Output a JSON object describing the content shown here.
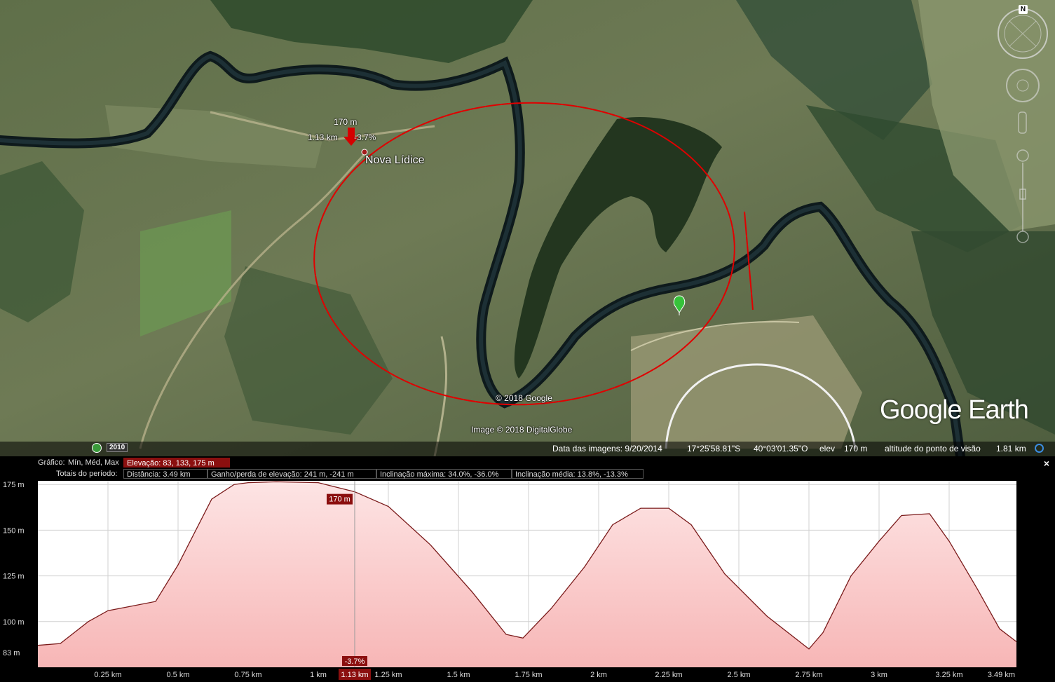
{
  "map": {
    "place_label": "Nova Lídice",
    "pointer_elevation": "170 m",
    "pointer_distance": "1.13 km",
    "pointer_slope": "-3.7%",
    "copyright_google": "© 2018 Google",
    "copyright_imagery": "Image © 2018 DigitalGlobe",
    "logo": "Google Earth",
    "historical_year": "2010",
    "compass_letter": "N"
  },
  "status": {
    "image_date_label": "Data das imagens: 9/20/2014",
    "latitude": "17°25'58.81\"S",
    "longitude": "40°03'01.35\"O",
    "elev_label": "elev",
    "elev_value": "170 m",
    "eye_alt_label": "altitude do ponto de visão",
    "eye_alt_value": "1.81 km"
  },
  "profile": {
    "graph_label": "Gráfico:",
    "graph_options": "Mín, Méd, Max",
    "elevation_stats": "Elevação: 83, 133, 175 m",
    "totals_label": "Totais do período:",
    "distance": "Distância: 3.49 km",
    "gain_loss": "Ganho/perda de elevação: 241 m, -241 m",
    "max_slope": "Inclinação máxima: 34.0%, -36.0%",
    "avg_slope": "Inclinação média: 13.8%, -13.3%",
    "close_symbol": "×",
    "cursor_elevation": "170 m",
    "cursor_slope": "-3.7%",
    "cursor_distance": "1.13 km"
  },
  "colors": {
    "profile_fill": "#f7b6b6",
    "profile_line": "#7a1a1a",
    "highlight": "#8b0f0f",
    "annotation": "#e00000"
  },
  "chart_data": {
    "type": "area",
    "xlabel": "",
    "ylabel": "",
    "x_unit": "km",
    "y_unit": "m",
    "xlim": [
      0,
      3.49
    ],
    "ylim": [
      75,
      177
    ],
    "y_ticks": [
      175,
      150,
      125,
      100,
      83
    ],
    "y_tick_labels": [
      "175 m",
      "150 m",
      "125 m",
      "100 m",
      "83 m"
    ],
    "x_ticks": [
      0.25,
      0.5,
      0.75,
      1,
      1.25,
      1.5,
      1.75,
      2,
      2.25,
      2.5,
      2.75,
      3,
      3.25,
      3.49
    ],
    "x_tick_labels": [
      "0.25 km",
      "0.5 km",
      "0.75 km",
      "1 km",
      "1.25 km",
      "1.5 km",
      "1.75 km",
      "2 km",
      "2.25 km",
      "2.5 km",
      "2.75 km",
      "3 km",
      "3.25 km",
      "3.49 km"
    ],
    "cursor_x": 1.13,
    "series": [
      {
        "x": [
          0,
          0.08,
          0.18,
          0.25,
          0.32,
          0.42,
          0.5,
          0.62,
          0.7,
          0.75,
          0.85,
          1.0,
          1.13,
          1.25,
          1.4,
          1.55,
          1.67,
          1.73,
          1.83,
          1.95,
          2.05,
          2.15,
          2.25,
          2.33,
          2.45,
          2.6,
          2.75,
          2.8,
          2.9,
          3.0,
          3.08,
          3.18,
          3.25,
          3.35,
          3.43,
          3.49
        ],
        "y": [
          87,
          88,
          100,
          106,
          108,
          111,
          131,
          167,
          175,
          176,
          176.5,
          176,
          171,
          163,
          142,
          116,
          93,
          91,
          107,
          130,
          153,
          162,
          162,
          153,
          126,
          103,
          85,
          94,
          125,
          144,
          158,
          159,
          144,
          118,
          96,
          89
        ]
      }
    ]
  }
}
